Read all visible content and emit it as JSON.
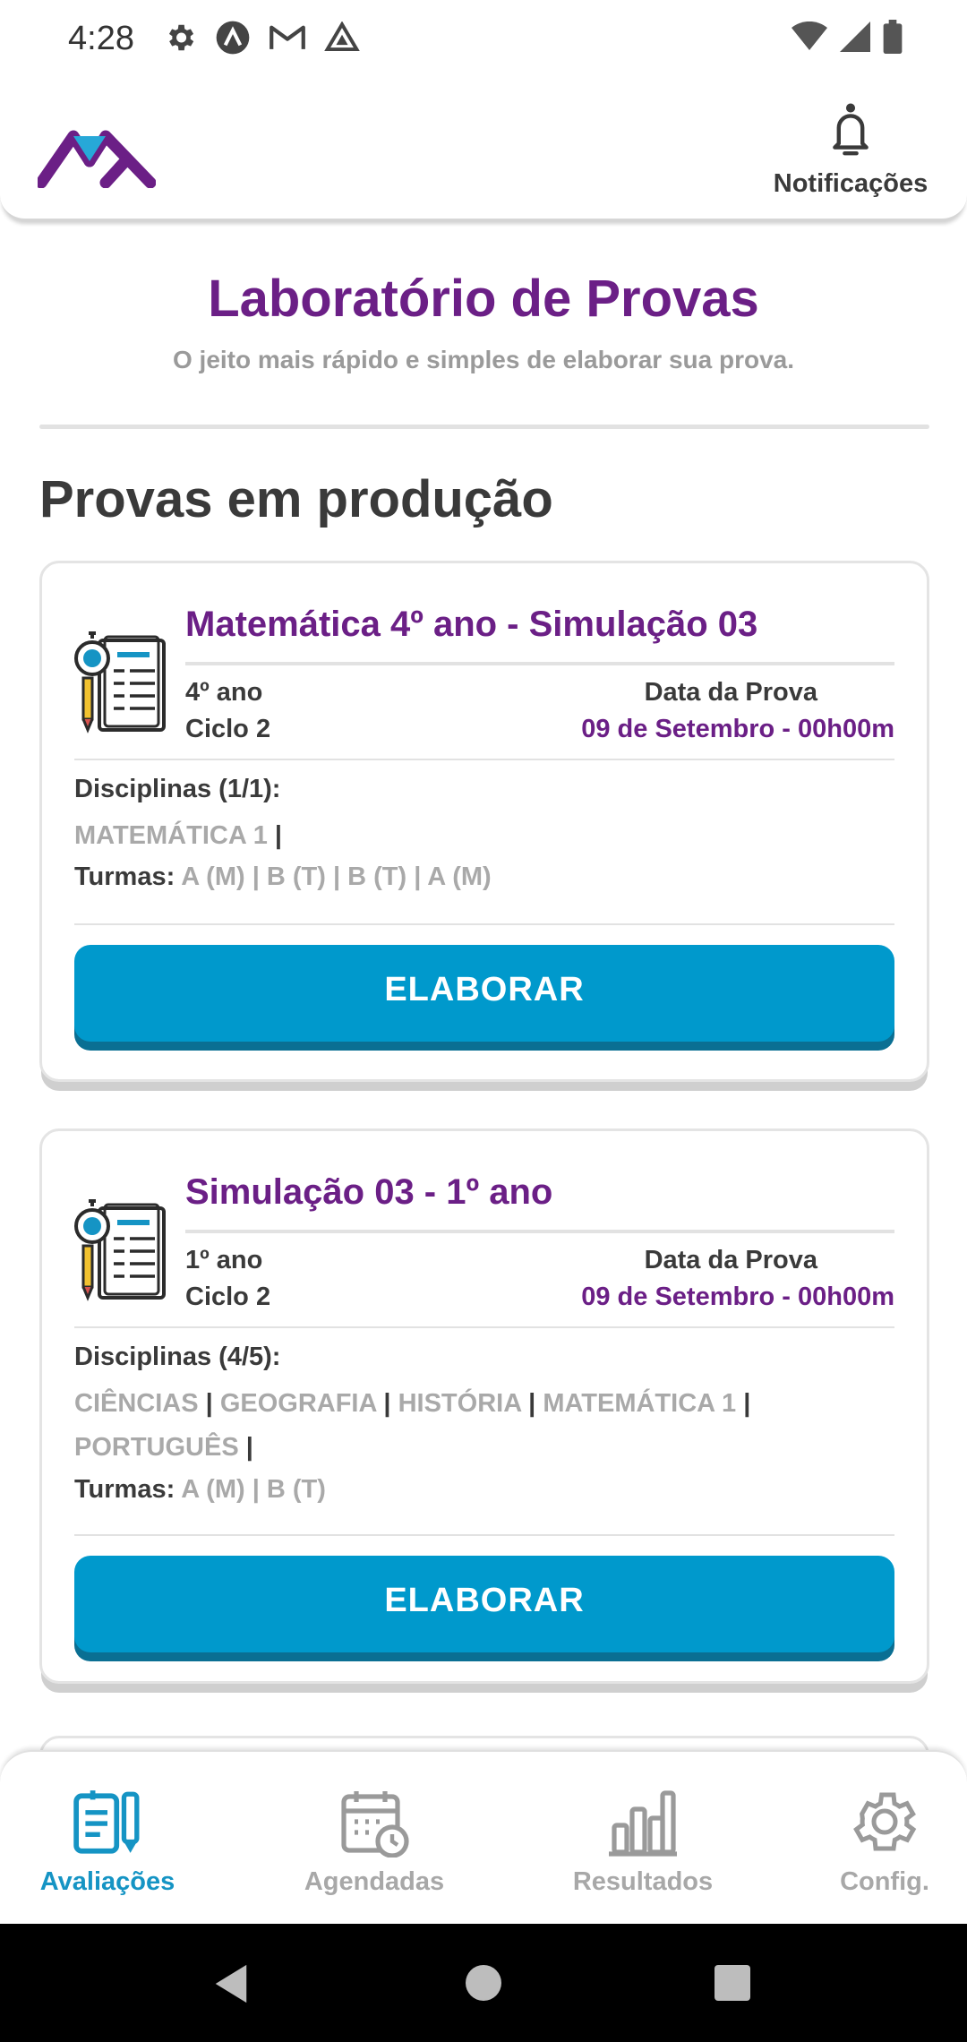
{
  "status_bar": {
    "time": "4:28",
    "left_icons": [
      "gear-icon",
      "circle-a-icon",
      "gmail-icon",
      "drive-icon"
    ],
    "right_icons": [
      "wifi-icon",
      "signal-icon",
      "battery-icon"
    ]
  },
  "header": {
    "logo": "app-logo",
    "notifications_label": "Notificações"
  },
  "hero": {
    "title": "Laboratório de Provas",
    "subtitle": "O jeito mais rápido e simples de elaborar sua prova."
  },
  "section_title": "Provas em produção",
  "cards": [
    {
      "title": "Matemática 4º ano - Simulação 03",
      "grade": "4º ano",
      "cycle": "Ciclo 2",
      "date_label": "Data da Prova",
      "date_value": "09 de Setembro - 00h00m",
      "disciplines_label": "Disciplinas (1/1):",
      "disciplines": [
        "MATEMÁTICA 1"
      ],
      "turmas_label": "Turmas:",
      "turmas_values": "A (M) | B (T) | B (T) | A (M)",
      "button_label": "ELABORAR"
    },
    {
      "title": "Simulação 03 - 1º ano",
      "grade": "1º ano",
      "cycle": "Ciclo 2",
      "date_label": "Data da Prova",
      "date_value": "09 de Setembro - 00h00m",
      "disciplines_label": "Disciplinas (4/5):",
      "disciplines": [
        "CIÊNCIAS",
        "GEOGRAFIA",
        "HISTÓRIA",
        "MATEMÁTICA 1",
        "PORTUGUÊS"
      ],
      "turmas_label": "Turmas:",
      "turmas_values": "A (M) | B (T)",
      "button_label": "ELABORAR"
    }
  ],
  "bottom_nav": [
    {
      "label": "Avaliações",
      "icon": "exam-edit-icon",
      "active": true
    },
    {
      "label": "Agendadas",
      "icon": "calendar-clock-icon",
      "active": false
    },
    {
      "label": "Resultados",
      "icon": "bar-chart-icon",
      "active": false
    },
    {
      "label": "Config.",
      "icon": "gear-icon",
      "active": false
    }
  ],
  "colors": {
    "brand_purple": "#6b1f86",
    "accent_blue": "#0099cc",
    "nav_active": "#1594c4",
    "muted_text": "#a9a9a9"
  }
}
